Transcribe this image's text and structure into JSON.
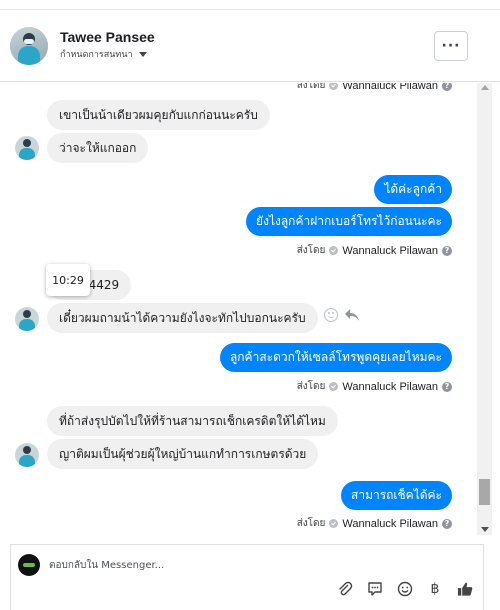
{
  "header": {
    "name": "Tawee Pansee",
    "subtitle": "กำหนดการสนทนา",
    "more_label": "···"
  },
  "thread": {
    "top_sentby": "ส่งโดย",
    "top_author": "Wannaluck Pilawan",
    "messages": [
      {
        "side": "in",
        "text": "เขาเป็นน้าเดียวผมคุยกับแกก่อนนะครับ"
      },
      {
        "side": "in",
        "text": "ว่าจะให้แกออก"
      },
      {
        "side": "out",
        "text": "ได้ค่ะลูกค้า"
      },
      {
        "side": "out",
        "text": "ยังไงลูกค้าฝากเบอร์โทรไว้ก่อนนะคะ"
      },
      {
        "side": "in",
        "text": "94429"
      },
      {
        "side": "in",
        "text": "เดี๋ยวผมถามน้าได้ความยังไงจะทักไปบอกนะครับ"
      },
      {
        "side": "out",
        "text": "ลูกค้าสะดวกให้เซลล์โทรพูดคุยเลยไหมคะ"
      },
      {
        "side": "in",
        "text": "ที่ถ้าส่งรุปบัตไปให้ที่ร้านสามารถเช็กเครดิตให้ได้ไหม"
      },
      {
        "side": "in",
        "text": "ญาติผมเป็นผุ้ช่วยผุ้ใหญ่บ้านแกทำการเกษตรด้วย"
      },
      {
        "side": "out",
        "text": "สามารถเช็คได้ค่ะ"
      }
    ],
    "sent_by_label": "ส่งโดย",
    "sent_by_author": "Wannaluck Pilawan",
    "tooltip_time": "10:29"
  },
  "composer": {
    "placeholder": "ตอบกลับใน Messenger...",
    "currency_symbol": "฿"
  },
  "colors": {
    "outgoing": "#0084ff",
    "incoming": "#f1f0f0"
  }
}
